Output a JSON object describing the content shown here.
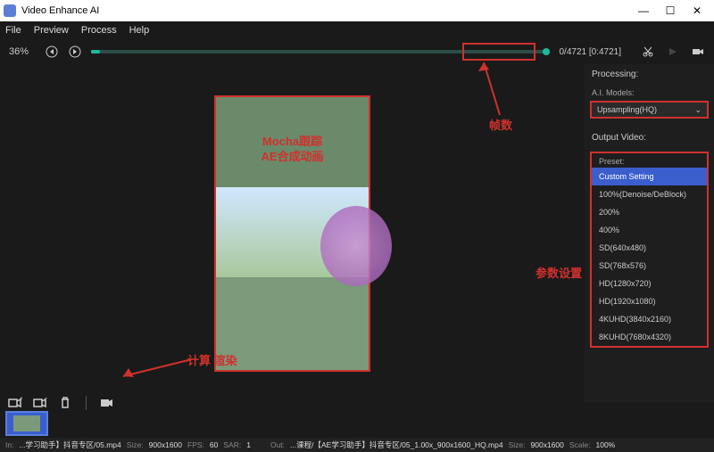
{
  "app": {
    "title": "Video Enhance AI"
  },
  "window": {
    "min": "—",
    "max": "☐",
    "close": "✕"
  },
  "menu": {
    "file": "File",
    "preview": "Preview",
    "process": "Process",
    "help": "Help"
  },
  "controls": {
    "percent": "36%",
    "frame_counter": "0/4721  [0:4721]"
  },
  "video_text": {
    "line1": "Mocha跟踪",
    "line2": "AE合成动画"
  },
  "side": {
    "processing": "Processing:",
    "models_label": "A.I. Models:",
    "model_selected": "Upsampling(HQ)",
    "output_label": "Output Video:",
    "preset_label": "Preset:",
    "presets": [
      "Custom Setting",
      "100%(Denoise/DeBlock)",
      "200%",
      "400%",
      "SD(640x480)",
      "SD(768x576)",
      "HD(1280x720)",
      "HD(1920x1080)",
      "4KUHD(3840x2160)",
      "8KUHD(7680x4320)"
    ]
  },
  "annotations": {
    "frames": "帧数",
    "render": "计算 渲染",
    "params": "参数设置"
  },
  "status": {
    "in_label": "In:",
    "in_val": "...学习助手】抖音专区/05.mp4",
    "size1_label": "Size:",
    "size1_val": "900x1600",
    "fps_label": "FPS:",
    "fps_val": "60",
    "sar_label": "SAR:",
    "sar_val": "1",
    "out_label": "Out:",
    "out_val": "...课程/【AE学习助手】抖音专区/05_1.00x_900x1600_HQ.mp4",
    "size2_label": "Size:",
    "size2_val": "900x1600",
    "scale_label": "Scale:",
    "scale_val": "100%"
  }
}
